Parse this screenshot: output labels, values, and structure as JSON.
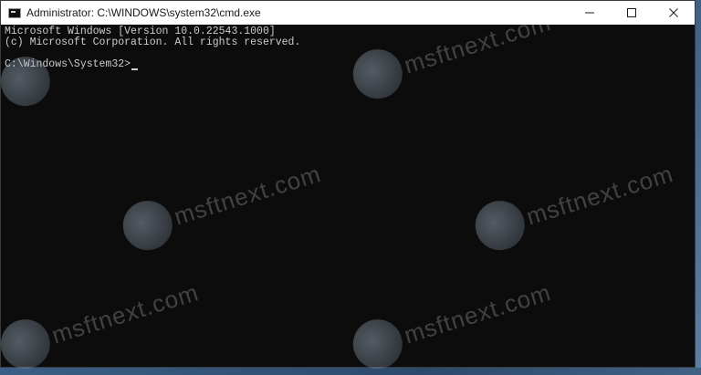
{
  "window": {
    "title": "Administrator: C:\\WINDOWS\\system32\\cmd.exe",
    "controls": [
      "minimize",
      "maximize",
      "close"
    ]
  },
  "console": {
    "lines": [
      "Microsoft Windows [Version 10.0.22543.1000]",
      "(c) Microsoft Corporation. All rights reserved.",
      "",
      "C:\\Windows\\System32>"
    ]
  },
  "watermark": {
    "text": "msftnext.com"
  },
  "colors": {
    "console_bg": "#0c0c0c",
    "console_text": "#cccccc",
    "titlebar_bg": "#ffffff"
  },
  "icons": {
    "app": "cmd-icon",
    "minimize": "minimize-icon",
    "maximize": "maximize-icon",
    "close": "close-icon"
  }
}
